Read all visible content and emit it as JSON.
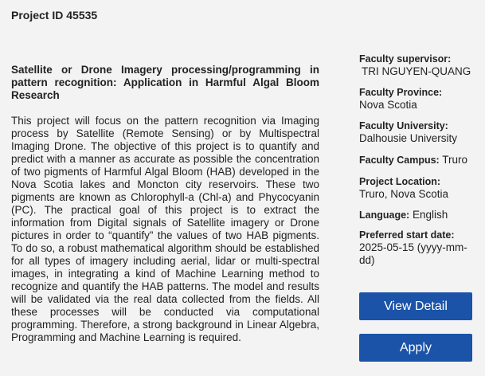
{
  "project": {
    "id_label": "Project ID 45535",
    "title": "Satellite or Drone Imagery processing/programming in pattern recognition: Application in Harmful Algal Bloom Research",
    "description": "This project will focus on the pattern recognition via Imaging process by Satellite (Remote Sensing) or by Multispectral Imaging Drone. The objective of this project is to quantify and predict with a manner as accurate as possible the concentration of two pigments of Harmful Algal Bloom (HAB) developed in the Nova Scotia lakes and Moncton city reservoirs. These two pigments are known as Chlorophyll-a (Chl-a) and Phycocyanin (PC). The practical goal of this project is to extract the information from Digital signals of Satellite imagery or Drone pictures in order to “quantify” the values of two HAB pigments. To do so, a robust mathematical algorithm should be established for all types of imagery including aerial, lidar or multi-spectral images, in integrating a kind of Machine Learning method to recognize and quantify the HAB patterns. The model and results will be validated via the real data collected from the fields. All these processes will be conducted via computational programming. Therefore, a strong background in Linear Algebra, Programming and Machine Learning is required."
  },
  "sidebar": {
    "supervisor_label": "Faculty supervisor:",
    "supervisor_value": "TRI NGUYEN-QUANG",
    "province_label": "Faculty Province:",
    "province_value": "Nova Scotia",
    "university_label": "Faculty University:",
    "university_value": "Dalhousie University",
    "campus_label": "Faculty Campus:",
    "campus_value": "Truro",
    "location_label": "Project Location:",
    "location_value": "Truro, Nova Scotia",
    "language_label": "Language:",
    "language_value": "English",
    "start_label": "Preferred start date:",
    "start_value": "2025-05-15 (yyyy-mm-dd)"
  },
  "actions": {
    "view_detail_label": "View Detail",
    "apply_label": "Apply"
  },
  "colors": {
    "button_bg": "#1a53a8",
    "page_bg": "#f3f3f3"
  }
}
